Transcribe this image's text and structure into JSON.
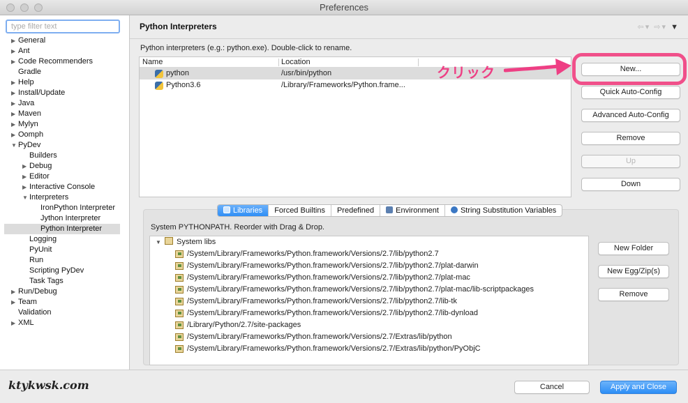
{
  "window": {
    "title": "Preferences"
  },
  "sidebar": {
    "filter_placeholder": "type filter text",
    "tree": [
      {
        "label": "General",
        "level": 0,
        "arrow": "right"
      },
      {
        "label": "Ant",
        "level": 0,
        "arrow": "right"
      },
      {
        "label": "Code Recommenders",
        "level": 0,
        "arrow": "right"
      },
      {
        "label": "Gradle",
        "level": 0,
        "arrow": ""
      },
      {
        "label": "Help",
        "level": 0,
        "arrow": "right"
      },
      {
        "label": "Install/Update",
        "level": 0,
        "arrow": "right"
      },
      {
        "label": "Java",
        "level": 0,
        "arrow": "right"
      },
      {
        "label": "Maven",
        "level": 0,
        "arrow": "right"
      },
      {
        "label": "Mylyn",
        "level": 0,
        "arrow": "right"
      },
      {
        "label": "Oomph",
        "level": 0,
        "arrow": "right"
      },
      {
        "label": "PyDev",
        "level": 0,
        "arrow": "down"
      },
      {
        "label": "Builders",
        "level": 1,
        "arrow": ""
      },
      {
        "label": "Debug",
        "level": 1,
        "arrow": "right"
      },
      {
        "label": "Editor",
        "level": 1,
        "arrow": "right"
      },
      {
        "label": "Interactive Console",
        "level": 1,
        "arrow": "right"
      },
      {
        "label": "Interpreters",
        "level": 1,
        "arrow": "down"
      },
      {
        "label": "IronPython Interpreter",
        "level": 2,
        "arrow": ""
      },
      {
        "label": "Jython Interpreter",
        "level": 2,
        "arrow": ""
      },
      {
        "label": "Python Interpreter",
        "level": 2,
        "arrow": "",
        "selected": true
      },
      {
        "label": "Logging",
        "level": 1,
        "arrow": ""
      },
      {
        "label": "PyUnit",
        "level": 1,
        "arrow": ""
      },
      {
        "label": "Run",
        "level": 1,
        "arrow": ""
      },
      {
        "label": "Scripting PyDev",
        "level": 1,
        "arrow": ""
      },
      {
        "label": "Task Tags",
        "level": 1,
        "arrow": ""
      },
      {
        "label": "Run/Debug",
        "level": 0,
        "arrow": "right"
      },
      {
        "label": "Team",
        "level": 0,
        "arrow": "right"
      },
      {
        "label": "Validation",
        "level": 0,
        "arrow": ""
      },
      {
        "label": "XML",
        "level": 0,
        "arrow": "right"
      }
    ]
  },
  "page": {
    "title": "Python Interpreters",
    "description": "Python interpreters (e.g.: python.exe).   Double-click to rename.",
    "columns": {
      "name": "Name",
      "location": "Location"
    },
    "interpreters": [
      {
        "name": "python",
        "location": "/usr/bin/python",
        "selected": true
      },
      {
        "name": "Python3.6",
        "location": "/Library/Frameworks/Python.frame..."
      }
    ],
    "buttons": {
      "new": "New...",
      "quick_auto_config": "Quick Auto-Config",
      "advanced_auto_config": "Advanced Auto-Config",
      "remove": "Remove",
      "up": "Up",
      "down": "Down"
    },
    "annotation": "クリック",
    "tabs": [
      "Libraries",
      "Forced Builtins",
      "Predefined",
      "Environment",
      "String Substitution Variables"
    ],
    "active_tab": "Libraries",
    "syspath_label": "System PYTHONPATH.   Reorder with Drag & Drop.",
    "system_libs_label": "System libs",
    "libs": [
      "/System/Library/Frameworks/Python.framework/Versions/2.7/lib/python2.7",
      "/System/Library/Frameworks/Python.framework/Versions/2.7/lib/python2.7/plat-darwin",
      "/System/Library/Frameworks/Python.framework/Versions/2.7/lib/python2.7/plat-mac",
      "/System/Library/Frameworks/Python.framework/Versions/2.7/lib/python2.7/plat-mac/lib-scriptpackages",
      "/System/Library/Frameworks/Python.framework/Versions/2.7/lib/python2.7/lib-tk",
      "/System/Library/Frameworks/Python.framework/Versions/2.7/lib/python2.7/lib-dynload",
      "/Library/Python/2.7/site-packages",
      "/System/Library/Frameworks/Python.framework/Versions/2.7/Extras/lib/python",
      "/System/Library/Frameworks/Python.framework/Versions/2.7/Extras/lib/python/PyObjC"
    ],
    "lib_buttons": {
      "new_folder": "New Folder",
      "new_egg": "New Egg/Zip(s)",
      "remove": "Remove"
    }
  },
  "footer": {
    "cancel": "Cancel",
    "apply_close": "Apply and Close",
    "logo": "ktykwsk.com"
  },
  "colors": {
    "accent": "#2d8ef6",
    "annotation": "#ee3f84"
  },
  "icons": {
    "interpreter": "python-icon",
    "library": "library-icon",
    "tabs": [
      "libraries-icon",
      "",
      "",
      "environment-icon",
      "string-substitution-icon"
    ]
  }
}
